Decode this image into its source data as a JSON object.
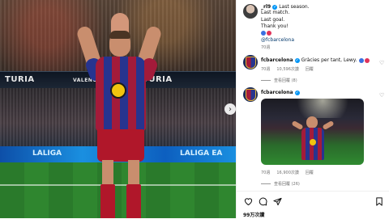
{
  "photo": {
    "band_left": "TURIA",
    "band_mid": "VALENCIA",
    "band_right": "TURIA",
    "adboard": "LALIGA",
    "adboard_right": "LALIGA EA"
  },
  "post": {
    "username": "_rl9",
    "caption_lines": [
      "Last season.",
      "Last match.",
      "Last goal.",
      "Thank you!"
    ],
    "emoji_hearts": [
      "#3b6fe0",
      "#e0335a"
    ],
    "mention": "@fcbarcelona",
    "time": "70週"
  },
  "comments": [
    {
      "username": "fcbarcelona",
      "text": "Gràcies per tant, Lewy.",
      "hearts": [
        "#3b6fe0",
        "#e0335a"
      ],
      "time": "70週",
      "likes": "10,596次讚",
      "reply": "回覆",
      "view_replies": "查看回覆 (8)"
    },
    {
      "username": "fcbarcelona",
      "time": "70週",
      "likes": "16,900次讚",
      "reply": "回覆",
      "view_replies": "查看回覆 (26)"
    }
  ],
  "actions": {
    "icons": [
      "heart-icon",
      "comment-icon",
      "share-icon",
      "bookmark-icon"
    ],
    "likes_text": "99万次讚"
  },
  "colors": {
    "verified": "#0095f6",
    "link": "#00376b",
    "muted": "#737373",
    "barca_red": "#a31b3a",
    "barca_blue": "#27348f"
  }
}
